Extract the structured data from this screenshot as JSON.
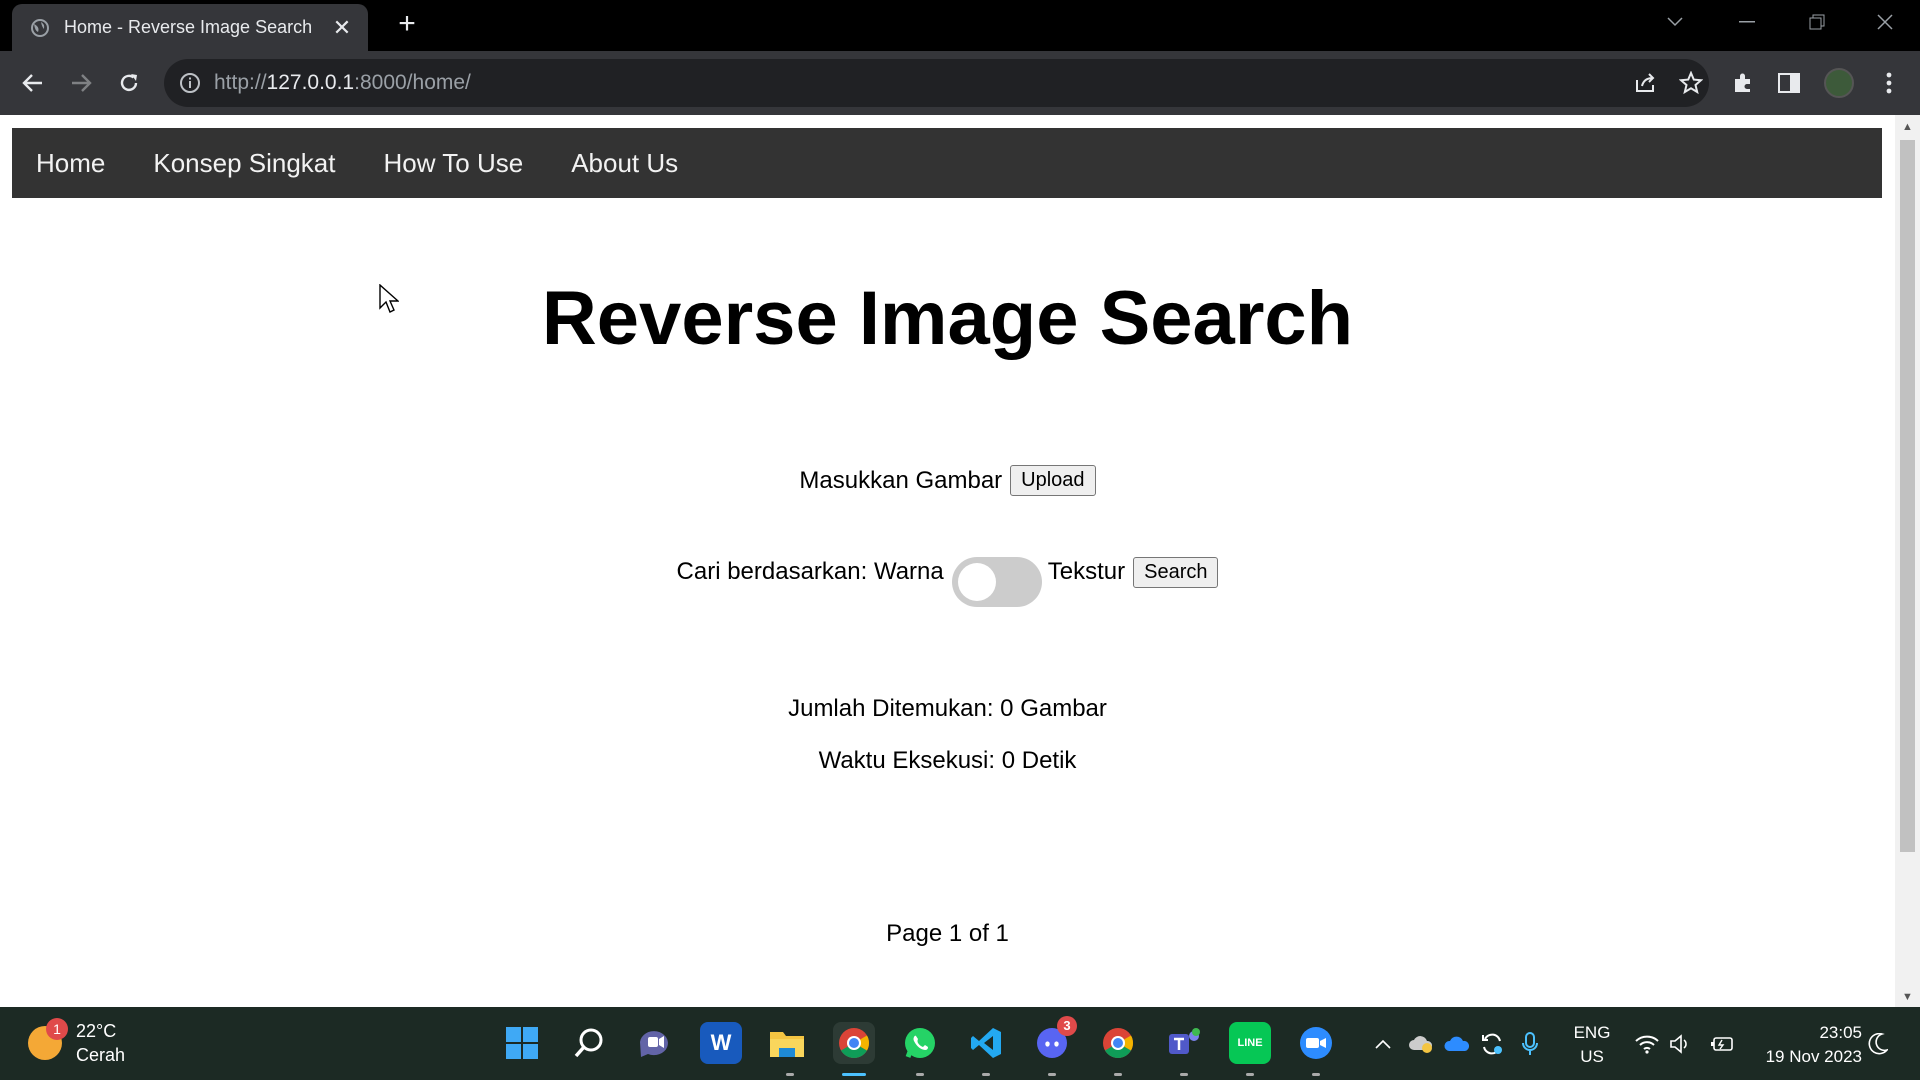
{
  "browser": {
    "tab_title": "Home - Reverse Image Search",
    "new_tab": "+",
    "tab_close": "✕",
    "url_prefix": "http://",
    "url_host": "127.0.0.1",
    "url_rest": ":8000/home/"
  },
  "nav": {
    "items": [
      "Home",
      "Konsep Singkat",
      "How To Use",
      "About Us"
    ]
  },
  "main": {
    "title": "Reverse Image Search",
    "upload_label": "Masukkan Gambar",
    "upload_button": "Upload",
    "search_by_label": "Cari berdasarkan: Warna",
    "texture_label": "Tekstur",
    "search_button": "Search",
    "found_text": "Jumlah Ditemukan: 0 Gambar",
    "time_text": "Waktu Eksekusi: 0 Detik",
    "pagination": "Page 1 of 1"
  },
  "taskbar": {
    "weather_badge": "1",
    "temperature": "22°C",
    "condition": "Cerah",
    "discord_badge": "3",
    "lang_top": "ENG",
    "lang_bottom": "US",
    "time": "23:05",
    "date": "19 Nov 2023",
    "apps": [
      "windows-start",
      "search",
      "chat",
      "word",
      "file-explorer",
      "chrome",
      "whatsapp",
      "vscode",
      "discord",
      "chrome-profile",
      "teams",
      "line",
      "zoom"
    ]
  },
  "colors": {
    "nav_bg": "#333333",
    "toggle_off": "#cccccc",
    "chrome_dark": "#35363a"
  }
}
